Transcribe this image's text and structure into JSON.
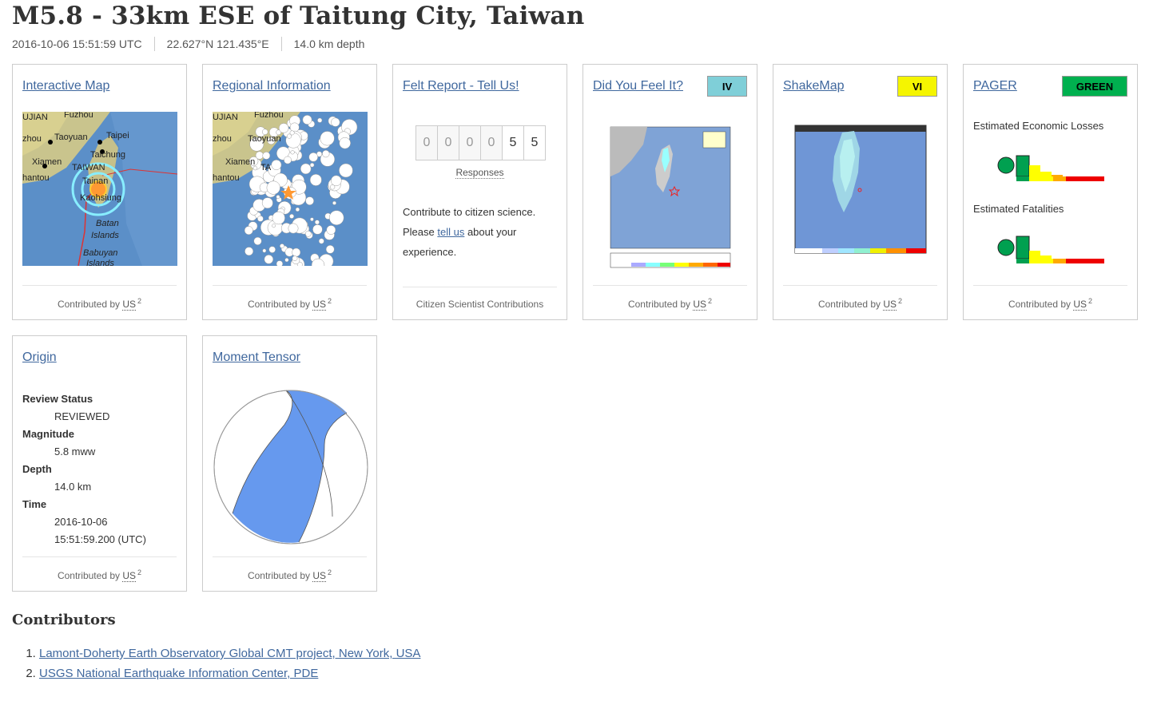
{
  "event": {
    "title": "M5.8 - 33km ESE of Taitung City, Taiwan",
    "time": "2016-10-06 15:51:59 UTC",
    "location": "22.627°N  121.435°E",
    "depth": "14.0 km depth"
  },
  "cards": {
    "interactive_map": {
      "title": "Interactive Map",
      "map_labels": [
        "UJIAN",
        "Fuzhou",
        "zhou",
        "Taipei",
        "Taoyuan",
        "Taichung",
        "TAIWAN",
        "Xiamen",
        "hantou",
        "Tainan",
        "Kaohsiung",
        "Batan",
        "Islands",
        "Babuyan",
        "Islands"
      ],
      "contributor": "US",
      "contributor_count": "2"
    },
    "regional_info": {
      "title": "Regional Information",
      "map_labels": [
        "UJIAN",
        "Fuzhou",
        "zhou",
        "Taoyuan",
        "Xiamen",
        "hantou",
        "TA"
      ],
      "contributor": "US",
      "contributor_count": "2"
    },
    "felt_report": {
      "title": "Felt Report - Tell Us!",
      "digits": [
        "0",
        "0",
        "0",
        "0",
        "5",
        "5"
      ],
      "responses_label": "Responses",
      "text_line1": "Contribute to citizen science.",
      "text_please": "Please ",
      "text_link": "tell us",
      "text_rest": " about your experience.",
      "footer": "Citizen Scientist Contributions"
    },
    "dyfi": {
      "title": "Did You Feel It?",
      "badge": "IV",
      "badge_color": "#7fcfd8",
      "contributor": "US",
      "contributor_count": "2"
    },
    "shakemap": {
      "title": "ShakeMap",
      "badge": "VI",
      "badge_color": "#f5f500",
      "contributor": "US",
      "contributor_count": "2"
    },
    "pager": {
      "title": "PAGER",
      "badge": "GREEN",
      "badge_color": "#00b04f",
      "losses_label": "Estimated Economic Losses",
      "fatalities_label": "Estimated Fatalities",
      "contributor": "US",
      "contributor_count": "2"
    },
    "origin": {
      "title": "Origin",
      "review_status_label": "Review Status",
      "review_status": "REVIEWED",
      "magnitude_label": "Magnitude",
      "magnitude": "5.8 mww",
      "depth_label": "Depth",
      "depth": "14.0 km",
      "time_label": "Time",
      "time_date": "2016-10-06",
      "time_clock": "15:51:59.200 (UTC)",
      "contributor": "US",
      "contributor_count": "2"
    },
    "moment_tensor": {
      "title": "Moment Tensor",
      "beachball_color": "#6699ee",
      "contributor": "US",
      "contributor_count": "2"
    }
  },
  "contributors": {
    "heading": "Contributors",
    "items": [
      "Lamont-Doherty Earth Observatory Global CMT project, New York, USA",
      "USGS National Earthquake Information Center, PDE"
    ]
  }
}
